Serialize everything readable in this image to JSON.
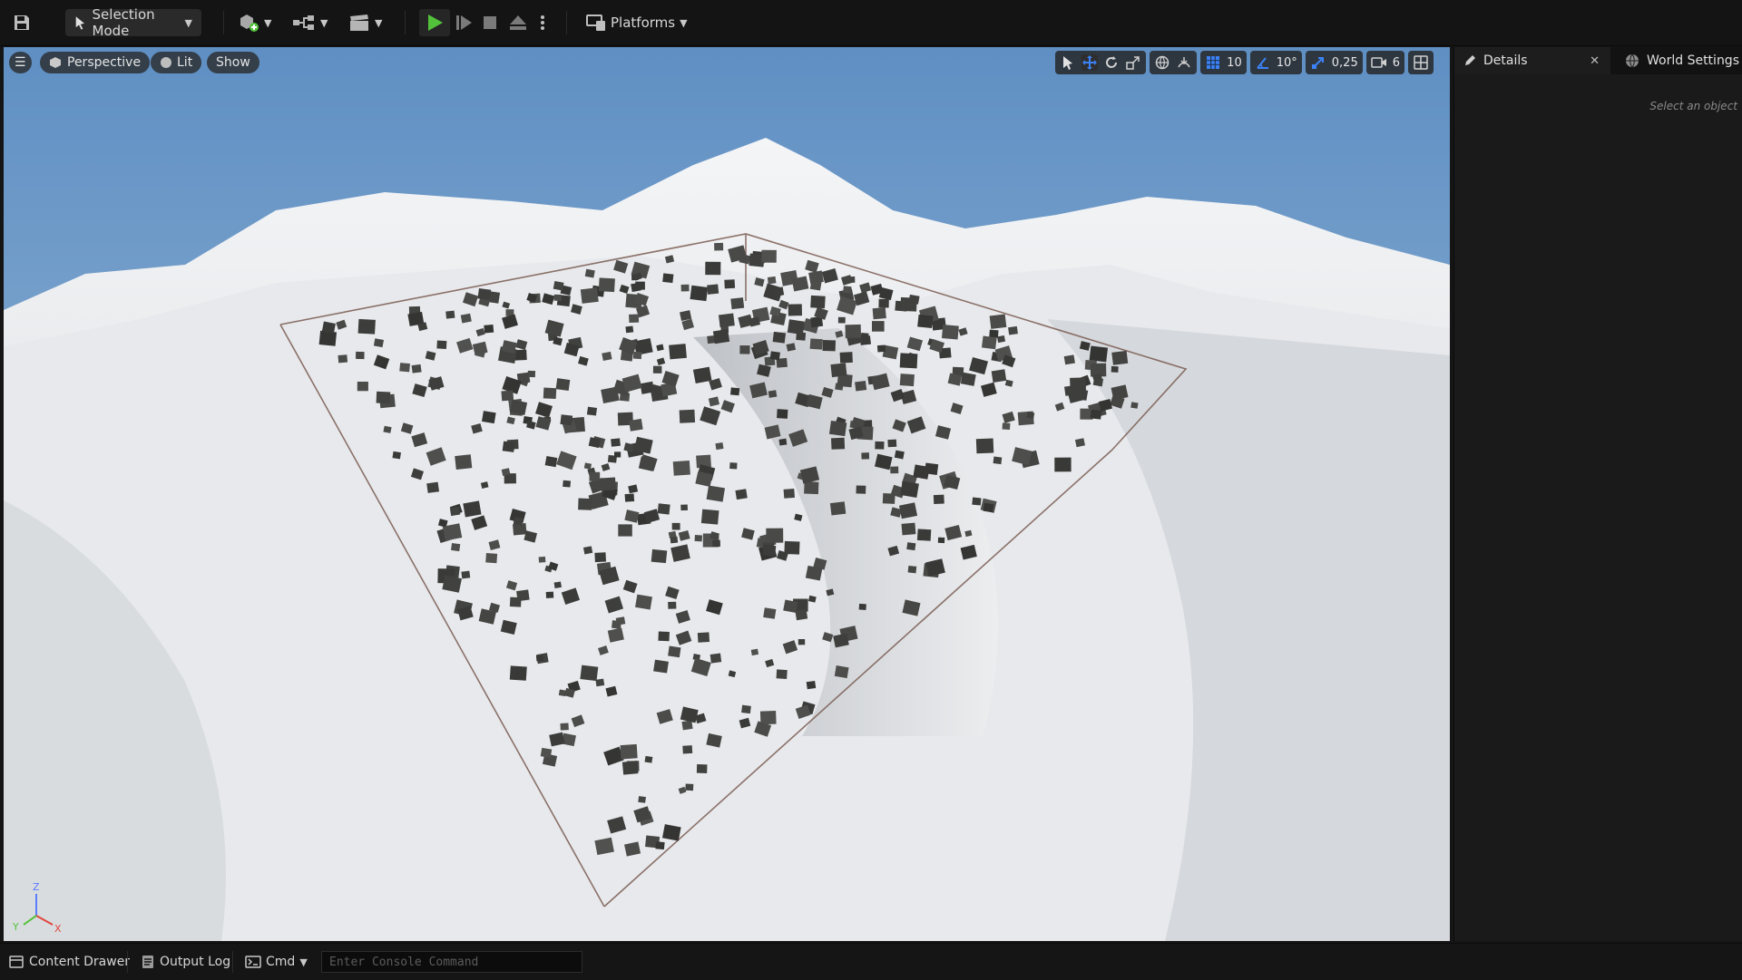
{
  "toolbar": {
    "selection_mode_label": "Selection Mode",
    "platforms_label": "Platforms"
  },
  "viewport": {
    "menu_icon": "hamburger-icon",
    "perspective_label": "Perspective",
    "lit_label": "Lit",
    "show_label": "Show",
    "tools": {
      "grid_snap_value": "10",
      "rotation_snap_value": "10°",
      "scale_snap_value": "0,25",
      "camera_speed_value": "6"
    },
    "axis": {
      "z": "Z",
      "y": "Y",
      "x": "X"
    }
  },
  "details_panel": {
    "tab_details_label": "Details",
    "tab_world_settings_label": "World Settings",
    "empty_hint": "Select an object"
  },
  "statusbar": {
    "content_drawer_label": "Content Drawer",
    "output_log_label": "Output Log",
    "cmd_label": "Cmd",
    "console_placeholder": "Enter Console Command"
  },
  "colors": {
    "play_green": "#53c23b",
    "snap_active_blue": "#3b82f6",
    "sky_blue": "#6b96c4"
  }
}
